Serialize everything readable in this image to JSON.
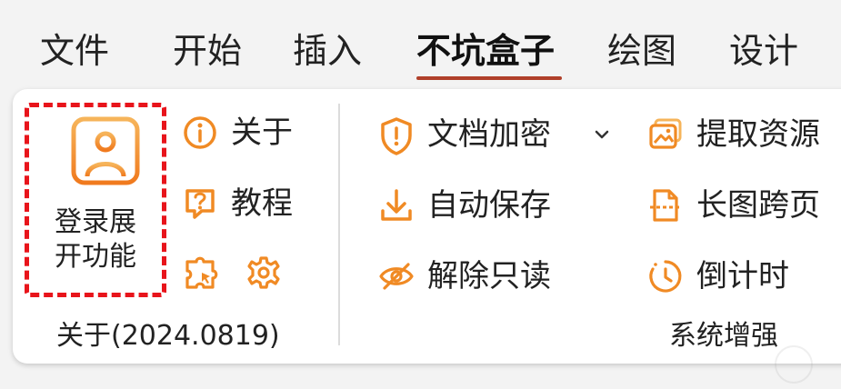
{
  "tabs": [
    "文件",
    "开始",
    "插入",
    "不坑盒子",
    "绘图",
    "设计"
  ],
  "active_tab": "不坑盒子",
  "about_group": {
    "login_label_line1": "登录展",
    "login_label_line2": "开功能",
    "about": "关于",
    "tutorial": "教程",
    "group_label": "关于(2024.0819)"
  },
  "enhance_group": {
    "encrypt": "文档加密",
    "autosave": "自动保存",
    "unlock_readonly": "解除只读",
    "extract_resources": "提取资源",
    "long_image_pages": "长图跨页",
    "countdown": "倒计时",
    "group_label": "系统增强"
  },
  "colors": {
    "accent": "#f08a24",
    "accent_light": "#f6b45a",
    "dashed_border": "#e8141b",
    "tab_underline": "#b0402a"
  },
  "icons": [
    "user-avatar-icon",
    "info-icon",
    "help-icon",
    "puzzle-icon",
    "gear-icon",
    "shield-icon",
    "download-icon",
    "eye-off-icon",
    "image-icon",
    "page-icon",
    "timer-icon",
    "chevron-down-icon"
  ]
}
